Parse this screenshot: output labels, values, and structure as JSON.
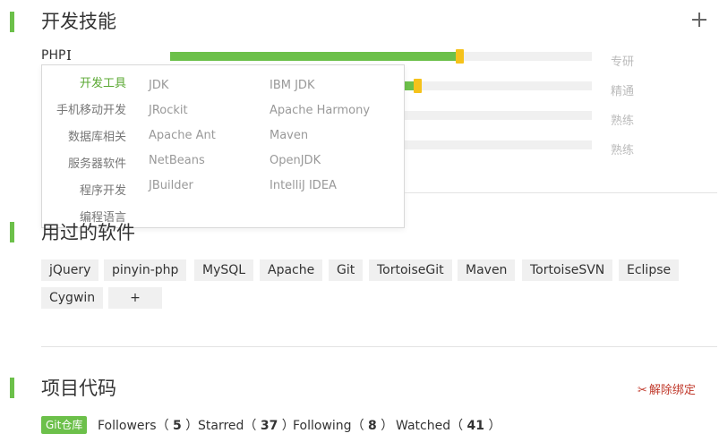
{
  "skills_section": {
    "title": "开发技能",
    "skills": [
      {
        "name": "PHP",
        "progress": 0.68,
        "level": "专研"
      },
      {
        "name": "",
        "progress": 0.58,
        "level": "精通"
      },
      {
        "name": "",
        "progress": 0.0,
        "level": "熟练"
      },
      {
        "name": "",
        "progress": 0.0,
        "level": "熟练"
      }
    ],
    "dropdown": {
      "categories": [
        "开发工具",
        "手机移动开发",
        "数据库相关",
        "服务器软件",
        "程序开发",
        "编程语言"
      ],
      "options_col1": [
        "JDK",
        "JRockit",
        "Apache Ant",
        "NetBeans",
        "JBuilder"
      ],
      "options_col2": [
        "IBM JDK",
        "Apache Harmony",
        "Maven",
        "OpenJDK",
        "IntelliJ IDEA"
      ]
    }
  },
  "software_section": {
    "title": "用过的软件",
    "tags": [
      "jQuery",
      "pinyin-php",
      "MySQL",
      "Apache",
      "Git",
      "TortoiseGit",
      "Maven",
      "TortoiseSVN",
      "Eclipse",
      "Cygwin"
    ],
    "add_label": "+"
  },
  "projects_section": {
    "title": "项目代码",
    "unbind_label": "解除绑定",
    "git_badge": "Git仓库",
    "followers_label": "Followers",
    "followers": "5",
    "starred_label": "Starred",
    "starred": "37",
    "following_label": "Following",
    "following": "8",
    "watched_label": "Watched",
    "watched": "41"
  },
  "colors": {
    "accent": "#6cc04a",
    "handle": "#f5c21b",
    "unbind": "#c0392b"
  }
}
